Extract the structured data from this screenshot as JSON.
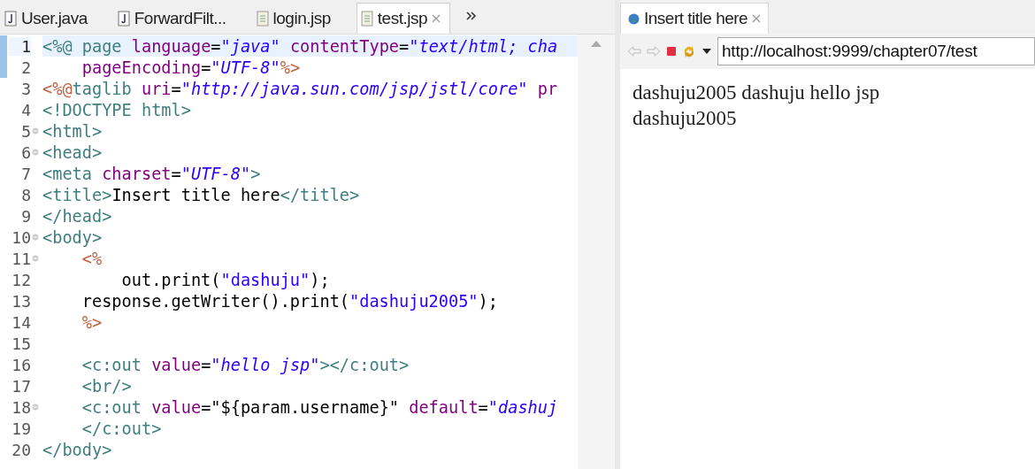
{
  "editor": {
    "tabs": [
      {
        "label": "User.java",
        "kind": "java",
        "selected": false
      },
      {
        "label": "ForwardFilt...",
        "kind": "java",
        "selected": false
      },
      {
        "label": "login.jsp",
        "kind": "jsp",
        "selected": false
      },
      {
        "label": "test.jsp",
        "kind": "jsp",
        "selected": true
      }
    ],
    "lines": [
      {
        "number": "1",
        "changed": true,
        "fold": false,
        "current": true,
        "segments": [
          {
            "text": "<%@ ",
            "kind": "tag"
          },
          {
            "text": "page ",
            "kind": "tag"
          },
          {
            "text": "language",
            "kind": "attr"
          },
          {
            "text": "=",
            "kind": "plain"
          },
          {
            "text": "\"java\"",
            "kind": "string"
          },
          {
            "text": " contentType",
            "kind": "attr"
          },
          {
            "text": "=",
            "kind": "plain"
          },
          {
            "text": "\"text/html; cha",
            "kind": "string"
          }
        ]
      },
      {
        "number": "2",
        "changed": true,
        "fold": false,
        "current": false,
        "segments": [
          {
            "text": "    pageEncoding",
            "kind": "attr"
          },
          {
            "text": "=",
            "kind": "plain"
          },
          {
            "text": "\"UTF-8\"",
            "kind": "string"
          },
          {
            "text": "%>",
            "kind": "jsp"
          }
        ]
      },
      {
        "number": "3",
        "changed": false,
        "fold": false,
        "current": false,
        "segments": [
          {
            "text": "<%@",
            "kind": "jsp"
          },
          {
            "text": "taglib ",
            "kind": "tag"
          },
          {
            "text": "uri",
            "kind": "attr"
          },
          {
            "text": "=",
            "kind": "plain"
          },
          {
            "text": "\"http://java.sun.com/jsp/jstl/core\"",
            "kind": "string"
          },
          {
            "text": " pr",
            "kind": "attr"
          }
        ]
      },
      {
        "number": "4",
        "changed": false,
        "fold": false,
        "current": false,
        "segments": [
          {
            "text": "<!DOCTYPE html>",
            "kind": "tag"
          }
        ]
      },
      {
        "number": "5",
        "changed": false,
        "fold": true,
        "current": false,
        "segments": [
          {
            "text": "<html>",
            "kind": "tag"
          }
        ]
      },
      {
        "number": "6",
        "changed": false,
        "fold": true,
        "current": false,
        "segments": [
          {
            "text": "<head>",
            "kind": "tag"
          }
        ]
      },
      {
        "number": "7",
        "changed": false,
        "fold": false,
        "current": false,
        "segments": [
          {
            "text": "<meta ",
            "kind": "tag"
          },
          {
            "text": "charset",
            "kind": "attr"
          },
          {
            "text": "=",
            "kind": "plain"
          },
          {
            "text": "\"UTF-8\"",
            "kind": "string"
          },
          {
            "text": ">",
            "kind": "tag"
          }
        ]
      },
      {
        "number": "8",
        "changed": false,
        "fold": false,
        "current": false,
        "segments": [
          {
            "text": "<title>",
            "kind": "tag"
          },
          {
            "text": "Insert title here",
            "kind": "plain"
          },
          {
            "text": "</title>",
            "kind": "tag"
          }
        ]
      },
      {
        "number": "9",
        "changed": false,
        "fold": false,
        "current": false,
        "segments": [
          {
            "text": "</head>",
            "kind": "tag"
          }
        ]
      },
      {
        "number": "10",
        "changed": false,
        "fold": true,
        "current": false,
        "segments": [
          {
            "text": "<body>",
            "kind": "tag"
          }
        ]
      },
      {
        "number": "11",
        "changed": false,
        "fold": true,
        "current": false,
        "segments": [
          {
            "text": "    <%",
            "kind": "jsp"
          }
        ]
      },
      {
        "number": "12",
        "changed": false,
        "fold": false,
        "current": false,
        "segments": [
          {
            "text": "        out.print(",
            "kind": "plain"
          },
          {
            "text": "\"dashuju\"",
            "kind": "java-string"
          },
          {
            "text": ");",
            "kind": "plain"
          }
        ]
      },
      {
        "number": "13",
        "changed": false,
        "fold": false,
        "current": false,
        "segments": [
          {
            "text": "    response.getWriter().print(",
            "kind": "plain"
          },
          {
            "text": "\"dashuju2005\"",
            "kind": "java-string"
          },
          {
            "text": ");",
            "kind": "plain"
          }
        ]
      },
      {
        "number": "14",
        "changed": false,
        "fold": false,
        "current": false,
        "segments": [
          {
            "text": "    %>",
            "kind": "jsp"
          }
        ]
      },
      {
        "number": "15",
        "changed": false,
        "fold": false,
        "current": false
      },
      {
        "number": "16",
        "changed": false,
        "fold": false,
        "current": false,
        "segments": [
          {
            "text": "    <c:out ",
            "kind": "tag"
          },
          {
            "text": "value",
            "kind": "attr"
          },
          {
            "text": "=",
            "kind": "plain"
          },
          {
            "text": "\"hello jsp\"",
            "kind": "string"
          },
          {
            "text": "></c:out>",
            "kind": "tag"
          }
        ]
      },
      {
        "number": "17",
        "changed": false,
        "fold": false,
        "current": false,
        "segments": [
          {
            "text": "    <br/>",
            "kind": "tag"
          }
        ]
      },
      {
        "number": "18",
        "changed": false,
        "fold": true,
        "current": false,
        "segments": [
          {
            "text": "    <c:out ",
            "kind": "tag"
          },
          {
            "text": "value",
            "kind": "attr"
          },
          {
            "text": "=",
            "kind": "plain"
          },
          {
            "text": "\"${param.username}\"",
            "kind": "plain"
          },
          {
            "text": " default",
            "kind": "attr"
          },
          {
            "text": "=",
            "kind": "plain"
          },
          {
            "text": "\"dashuj",
            "kind": "string"
          }
        ]
      },
      {
        "number": "19",
        "changed": false,
        "fold": false,
        "current": false,
        "segments": [
          {
            "text": "    </c:out>",
            "kind": "tag"
          }
        ]
      },
      {
        "number": "20",
        "changed": false,
        "fold": false,
        "current": false,
        "segments": [
          {
            "text": "</body>",
            "kind": "tag"
          }
        ]
      }
    ]
  },
  "browser": {
    "tab": {
      "label": "Insert title here",
      "selected": true
    },
    "url": "http://localhost:9999/chapter07/test",
    "content": [
      "dashuju2005 dashuju hello jsp",
      "dashuju2005"
    ]
  }
}
